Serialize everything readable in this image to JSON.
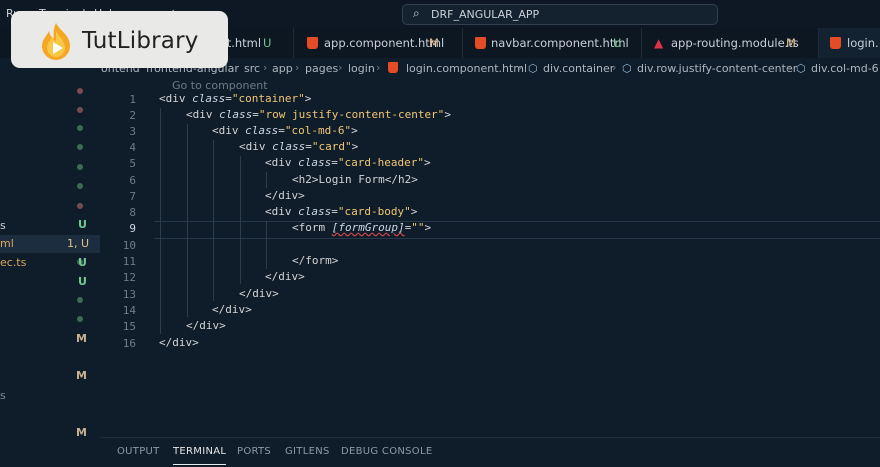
{
  "titlebar": {
    "menu": [
      "Run",
      "Terminal",
      "Help"
    ],
    "search_icon": "search-icon",
    "command_center": "DRF_ANGULAR_APP"
  },
  "logo": {
    "text": "TutLibrary"
  },
  "tabs": [
    {
      "name": "onent.html",
      "status": "U",
      "icon": "html-icon"
    },
    {
      "name": "app.component.html",
      "status": "M",
      "icon": "html-icon"
    },
    {
      "name": "navbar.component.html",
      "status": "U",
      "icon": "html-icon"
    },
    {
      "name": "app-routing.module.ts",
      "status": "M",
      "icon": "angular-icon"
    },
    {
      "name": "login.",
      "status": "",
      "icon": "html-icon"
    }
  ],
  "breadcrumbs": [
    "ontend",
    "frontend-angular",
    "src",
    "app",
    "pages",
    "login",
    "login.component.html",
    "div.container",
    "div.row.justify-content-center",
    "div.col-md-6"
  ],
  "explorer": {
    "names": [
      "s",
      "ml",
      "ec.ts",
      "s"
    ],
    "markers": [
      "U",
      "1, U",
      "U",
      "U",
      "M",
      "M",
      "M"
    ]
  },
  "editor": {
    "codelens": "Go to component",
    "line_numbers": [
      "1",
      "2",
      "3",
      "4",
      "5",
      "6",
      "7",
      "8",
      "9",
      "10",
      "11",
      "12",
      "13",
      "14",
      "15",
      "16"
    ],
    "current_line": "9",
    "l1": {
      "a": "<div ",
      "b": "class",
      "c": "=",
      "d": "\"container\"",
      "e": ">"
    },
    "l2": {
      "a": "<div ",
      "b": "class",
      "c": "=",
      "d": "\"row justify-content-center\"",
      "e": ">"
    },
    "l3": {
      "a": "<div ",
      "b": "class",
      "c": "=",
      "d": "\"col-md-6\"",
      "e": ">"
    },
    "l4": {
      "a": "<div ",
      "b": "class",
      "c": "=",
      "d": "\"card\"",
      "e": ">"
    },
    "l5": {
      "a": "<div ",
      "b": "class",
      "c": "=",
      "d": "\"card-header\"",
      "e": ">"
    },
    "l6": "<h2>Login Form</h2>",
    "l7": "</div>",
    "l8": {
      "a": "<div ",
      "b": "class",
      "c": "=",
      "d": "\"card-body\"",
      "e": ">"
    },
    "l9": {
      "a": "<form ",
      "b": "[formGroup]",
      "c": "=",
      "d": "\"\"",
      "e": ">"
    },
    "l11": "</form>",
    "l12": "</div>",
    "l13": "</div>",
    "l14": "</div>",
    "l15": "</div>",
    "l16": "</div>"
  },
  "panel": {
    "tabs": [
      "OUTPUT",
      "TERMINAL",
      "PORTS",
      "GITLENS",
      "DEBUG CONSOLE"
    ],
    "active": "TERMINAL"
  },
  "colors": {
    "background": "#0f1d2b",
    "untracked": "#73c991",
    "modified": "#e2c08d",
    "attr_value": "#f0c674"
  }
}
